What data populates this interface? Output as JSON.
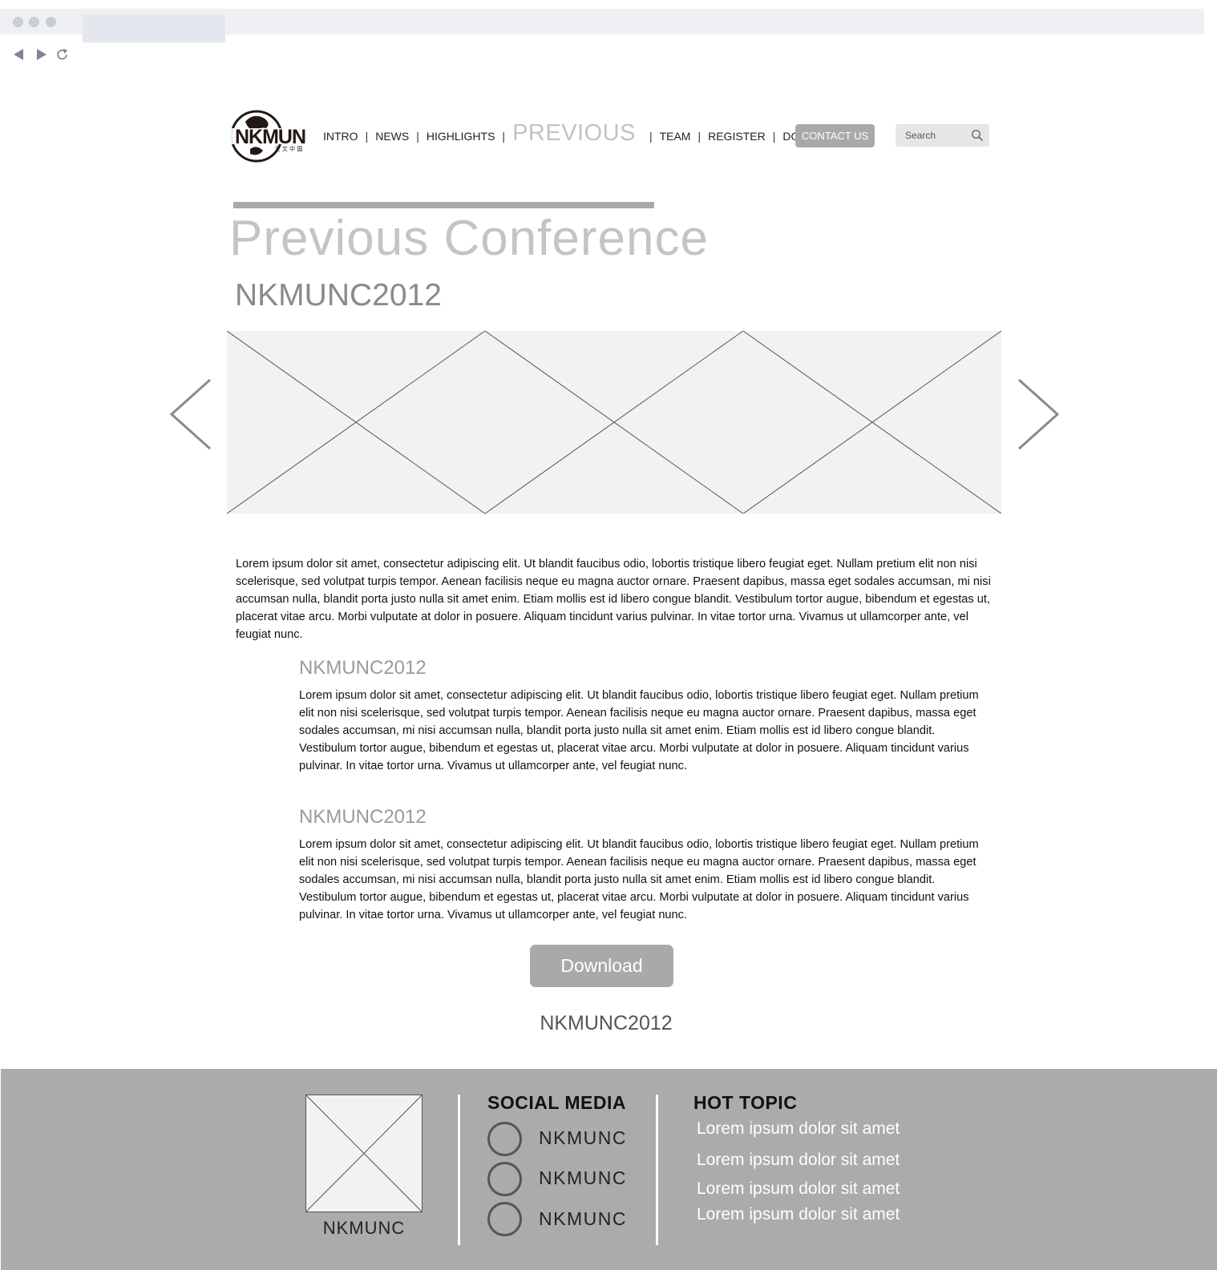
{
  "colors": {
    "chrome_bar": "#eef0f4",
    "accent_gray": "#a9a9a9",
    "title_gray": "#c4c4c4",
    "placeholder_fill": "#f2f2f2",
    "footer_bg": "#ababab",
    "footer_text": "#ffffff"
  },
  "browser": {
    "back_icon": "back-arrow-icon",
    "forward_icon": "forward-arrow-icon",
    "reload_icon": "reload-icon"
  },
  "header": {
    "logo_text": "NKMUN",
    "logo_subtext": "汇 文 中 国",
    "nav": [
      {
        "label": "INTRO"
      },
      {
        "label": "NEWS"
      },
      {
        "label": "HIGHLIGHTS"
      },
      {
        "label": "PREVIOUS"
      },
      {
        "label": "TEAM"
      },
      {
        "label": "REGISTER"
      },
      {
        "label": "DOWNLOAD"
      }
    ],
    "nav_separator": "|",
    "contact_label": "CONTACT US",
    "search_placeholder": "Search",
    "search_icon": "magnifier-icon"
  },
  "main": {
    "page_title": "Previous Conference",
    "subtitle": "NKMUNC2012",
    "carousel": {
      "prev_icon": "chevron-left-icon",
      "next_icon": "chevron-right-icon"
    },
    "intro_text": "Lorem ipsum dolor sit amet, consectetur adipiscing elit. Ut blandit faucibus odio, lobortis tristique libero feugiat eget. Nullam pretium elit non nisi scelerisque, sed volutpat turpis tempor. Aenean facilisis neque eu magna auctor ornare. Praesent dapibus, massa eget sodales accumsan, mi nisi accumsan nulla, blandit porta justo nulla sit amet enim. Etiam mollis est id libero congue blandit. Vestibulum tortor augue, bibendum et egestas ut, placerat vitae arcu. Morbi vulputate at dolor in posuere. Aliquam tincidunt varius pulvinar. In vitae tortor urna. Vivamus ut ullamcorper ante, vel feugiat nunc.",
    "sections": [
      {
        "title": "NKMUNC2012",
        "text": "Lorem ipsum dolor sit amet, consectetur adipiscing elit. Ut blandit faucibus odio, lobortis tristique libero feugiat eget. Nullam pretium elit non nisi scelerisque, sed volutpat turpis tempor. Aenean facilisis neque eu magna auctor ornare. Praesent dapibus, massa eget sodales accumsan, mi nisi accumsan nulla, blandit porta justo nulla sit amet enim. Etiam mollis est id libero congue blandit. Vestibulum tortor augue, bibendum et egestas ut, placerat vitae arcu. Morbi vulputate at dolor in posuere. Aliquam tincidunt varius pulvinar. In vitae tortor urna. Vivamus ut ullamcorper ante, vel feugiat nunc."
      },
      {
        "title": "NKMUNC2012",
        "text": "Lorem ipsum dolor sit amet, consectetur adipiscing elit. Ut blandit faucibus odio, lobortis tristique libero feugiat eget. Nullam pretium elit non nisi scelerisque, sed volutpat turpis tempor. Aenean facilisis neque eu magna auctor ornare. Praesent dapibus, massa eget sodales accumsan, mi nisi accumsan nulla, blandit porta justo nulla sit amet enim. Etiam mollis est id libero congue blandit. Vestibulum tortor augue, bibendum et egestas ut, placerat vitae arcu. Morbi vulputate at dolor in posuere. Aliquam tincidunt varius pulvinar. In vitae tortor urna. Vivamus ut ullamcorper ante, vel feugiat nunc."
      }
    ],
    "download_label": "Download",
    "bottom_label": "NKMUNC2012"
  },
  "footer": {
    "image_label": "NKMUNC",
    "social_heading": "SOCIAL MEDIA",
    "social": [
      {
        "label": "NKMUNC"
      },
      {
        "label": "NKMUNC"
      },
      {
        "label": "NKMUNC"
      }
    ],
    "hot_heading": "HOT TOPIC",
    "topics": [
      "Lorem ipsum dolor sit amet",
      "Lorem ipsum dolor sit amet",
      "Lorem ipsum dolor sit amet",
      "Lorem ipsum dolor sit amet"
    ]
  }
}
